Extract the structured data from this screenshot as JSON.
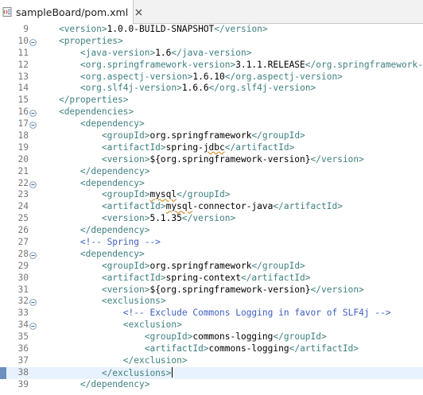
{
  "tab": {
    "title": "sampleBoard/pom.xml",
    "icon": "xml-file-icon",
    "close_icon": "close-icon"
  },
  "colors": {
    "tag": "#3f7f7f",
    "text": "#000000",
    "comment": "#3f5fbf",
    "line_number": "#787878",
    "current_line": "#e8f2fe",
    "modified_marker": "#6b8fbf"
  },
  "lines": [
    {
      "num": "9",
      "fold": "",
      "modified": false,
      "current": false,
      "indent": 1,
      "parts": [
        {
          "t": "tag",
          "v": "<version>"
        },
        {
          "t": "text",
          "v": "1.0.0-BUILD-SNAPSHOT"
        },
        {
          "t": "tag",
          "v": "</version>"
        }
      ]
    },
    {
      "num": "10",
      "fold": "minus",
      "modified": false,
      "current": false,
      "indent": 1,
      "parts": [
        {
          "t": "tag",
          "v": "<properties>"
        }
      ]
    },
    {
      "num": "11",
      "fold": "",
      "modified": false,
      "current": false,
      "indent": 2,
      "parts": [
        {
          "t": "tag",
          "v": "<java-version>"
        },
        {
          "t": "text",
          "v": "1.6"
        },
        {
          "t": "tag",
          "v": "</java-version>"
        }
      ]
    },
    {
      "num": "12",
      "fold": "",
      "modified": false,
      "current": false,
      "indent": 2,
      "parts": [
        {
          "t": "tag",
          "v": "<org.springframework-version>"
        },
        {
          "t": "text",
          "v": "3.1.1.RELEASE"
        },
        {
          "t": "tag",
          "v": "</org.springframework-version>"
        }
      ]
    },
    {
      "num": "13",
      "fold": "",
      "modified": false,
      "current": false,
      "indent": 2,
      "parts": [
        {
          "t": "tag",
          "v": "<org.aspectj-version>"
        },
        {
          "t": "text",
          "v": "1.6.10"
        },
        {
          "t": "tag",
          "v": "</org.aspectj-version>"
        }
      ]
    },
    {
      "num": "14",
      "fold": "",
      "modified": false,
      "current": false,
      "indent": 2,
      "parts": [
        {
          "t": "tag",
          "v": "<org.slf4j-version>"
        },
        {
          "t": "text",
          "v": "1.6.6"
        },
        {
          "t": "tag",
          "v": "</org.slf4j-version>"
        }
      ]
    },
    {
      "num": "15",
      "fold": "",
      "modified": false,
      "current": false,
      "indent": 1,
      "parts": [
        {
          "t": "tag",
          "v": "</properties>"
        }
      ]
    },
    {
      "num": "16",
      "fold": "minus",
      "modified": false,
      "current": false,
      "indent": 1,
      "parts": [
        {
          "t": "tag",
          "v": "<dependencies>"
        }
      ]
    },
    {
      "num": "17",
      "fold": "minus",
      "modified": false,
      "current": false,
      "indent": 2,
      "parts": [
        {
          "t": "tag",
          "v": "<dependency>"
        }
      ]
    },
    {
      "num": "18",
      "fold": "",
      "modified": false,
      "current": false,
      "indent": 3,
      "parts": [
        {
          "t": "tag",
          "v": "<groupId>"
        },
        {
          "t": "text",
          "v": "org.springframework"
        },
        {
          "t": "tag",
          "v": "</groupId>"
        }
      ]
    },
    {
      "num": "19",
      "fold": "",
      "modified": false,
      "current": false,
      "indent": 3,
      "parts": [
        {
          "t": "tag",
          "v": "<artifactId>"
        },
        {
          "t": "text",
          "v": "spring-"
        },
        {
          "t": "squiggle",
          "v": "jdbc"
        },
        {
          "t": "tag",
          "v": "</artifactId>"
        }
      ]
    },
    {
      "num": "20",
      "fold": "",
      "modified": false,
      "current": false,
      "indent": 3,
      "parts": [
        {
          "t": "tag",
          "v": "<version>"
        },
        {
          "t": "text",
          "v": "${org.springframework-version}"
        },
        {
          "t": "tag",
          "v": "</version>"
        }
      ]
    },
    {
      "num": "21",
      "fold": "",
      "modified": false,
      "current": false,
      "indent": 2,
      "parts": [
        {
          "t": "tag",
          "v": "</dependency>"
        }
      ]
    },
    {
      "num": "22",
      "fold": "minus",
      "modified": false,
      "current": false,
      "indent": 2,
      "parts": [
        {
          "t": "tag",
          "v": "<dependency>"
        }
      ]
    },
    {
      "num": "23",
      "fold": "",
      "modified": false,
      "current": false,
      "indent": 3,
      "parts": [
        {
          "t": "tag",
          "v": "<groupId>"
        },
        {
          "t": "squiggle",
          "v": "mysql"
        },
        {
          "t": "tag",
          "v": "</groupId>"
        }
      ]
    },
    {
      "num": "24",
      "fold": "",
      "modified": false,
      "current": false,
      "indent": 3,
      "parts": [
        {
          "t": "tag",
          "v": "<artifactId>"
        },
        {
          "t": "squiggle",
          "v": "mysql"
        },
        {
          "t": "text",
          "v": "-connector-java"
        },
        {
          "t": "tag",
          "v": "</artifactId>"
        }
      ]
    },
    {
      "num": "25",
      "fold": "",
      "modified": false,
      "current": false,
      "indent": 3,
      "parts": [
        {
          "t": "tag",
          "v": "<version>"
        },
        {
          "t": "text",
          "v": "5.1.35"
        },
        {
          "t": "tag",
          "v": "</version>"
        }
      ]
    },
    {
      "num": "26",
      "fold": "",
      "modified": false,
      "current": false,
      "indent": 2,
      "parts": [
        {
          "t": "tag",
          "v": "</dependency>"
        }
      ]
    },
    {
      "num": "27",
      "fold": "",
      "modified": false,
      "current": false,
      "indent": 2,
      "parts": [
        {
          "t": "comment",
          "v": "<!-- Spring -->"
        }
      ]
    },
    {
      "num": "28",
      "fold": "minus",
      "modified": false,
      "current": false,
      "indent": 2,
      "parts": [
        {
          "t": "tag",
          "v": "<dependency>"
        }
      ]
    },
    {
      "num": "29",
      "fold": "",
      "modified": false,
      "current": false,
      "indent": 3,
      "parts": [
        {
          "t": "tag",
          "v": "<groupId>"
        },
        {
          "t": "text",
          "v": "org.springframework"
        },
        {
          "t": "tag",
          "v": "</groupId>"
        }
      ]
    },
    {
      "num": "30",
      "fold": "",
      "modified": false,
      "current": false,
      "indent": 3,
      "parts": [
        {
          "t": "tag",
          "v": "<artifactId>"
        },
        {
          "t": "text",
          "v": "spring-context"
        },
        {
          "t": "tag",
          "v": "</artifactId>"
        }
      ]
    },
    {
      "num": "31",
      "fold": "",
      "modified": false,
      "current": false,
      "indent": 3,
      "parts": [
        {
          "t": "tag",
          "v": "<version>"
        },
        {
          "t": "text",
          "v": "${org.springframework-version}"
        },
        {
          "t": "tag",
          "v": "</version>"
        }
      ]
    },
    {
      "num": "32",
      "fold": "minus",
      "modified": false,
      "current": false,
      "indent": 3,
      "parts": [
        {
          "t": "tag",
          "v": "<exclusions>"
        }
      ]
    },
    {
      "num": "33",
      "fold": "",
      "modified": false,
      "current": false,
      "indent": 4,
      "parts": [
        {
          "t": "comment",
          "v": "<!-- Exclude Commons Logging in favor of SLF4j -->"
        }
      ]
    },
    {
      "num": "34",
      "fold": "minus",
      "modified": false,
      "current": false,
      "indent": 4,
      "parts": [
        {
          "t": "tag",
          "v": "<exclusion>"
        }
      ]
    },
    {
      "num": "35",
      "fold": "",
      "modified": false,
      "current": false,
      "indent": 5,
      "parts": [
        {
          "t": "tag",
          "v": "<groupId>"
        },
        {
          "t": "text",
          "v": "commons-logging"
        },
        {
          "t": "tag",
          "v": "</groupId>"
        }
      ]
    },
    {
      "num": "36",
      "fold": "",
      "modified": false,
      "current": false,
      "indent": 5,
      "parts": [
        {
          "t": "tag",
          "v": "<artifactId>"
        },
        {
          "t": "text",
          "v": "commons-logging"
        },
        {
          "t": "tag",
          "v": "</artifactId>"
        }
      ]
    },
    {
      "num": "37",
      "fold": "",
      "modified": false,
      "current": false,
      "indent": 4,
      "parts": [
        {
          "t": "tag",
          "v": "</exclusion>"
        }
      ]
    },
    {
      "num": "38",
      "fold": "",
      "modified": true,
      "current": true,
      "indent": 3,
      "parts": [
        {
          "t": "tag",
          "v": "</exclusions>"
        }
      ],
      "caret": true
    },
    {
      "num": "39",
      "fold": "",
      "modified": false,
      "current": false,
      "indent": 2,
      "parts": [
        {
          "t": "tag",
          "v": "</dependency>"
        }
      ]
    }
  ]
}
